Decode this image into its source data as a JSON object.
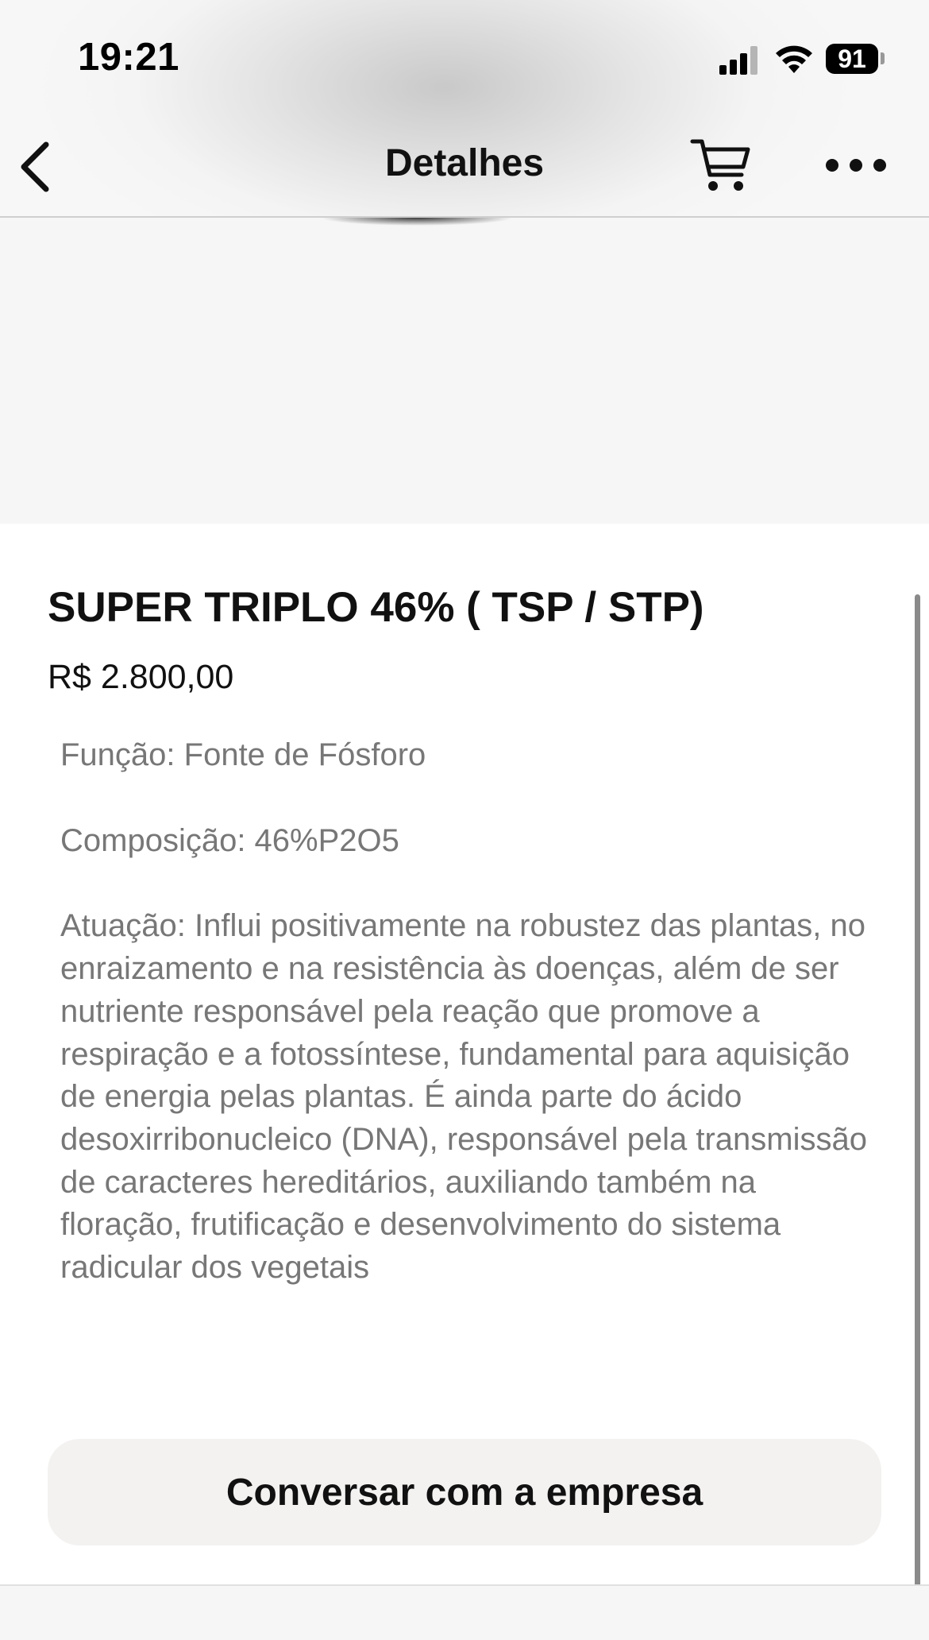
{
  "status_bar": {
    "time": "19:21",
    "battery": "91"
  },
  "nav": {
    "title": "Detalhes"
  },
  "product": {
    "title": "SUPER TRIPLO 46% ( TSP / STP)",
    "price": "R$ 2.800,00",
    "description": {
      "function": "Função: Fonte de Fósforo",
      "composition": "Composição: 46%P2O5",
      "action": "Atuação: Influi positivamente na robustez das plantas, no enraizamento e na resistência às doenças, além de ser nutriente responsável pela reação que promove a respiração e a fotossíntese, fundamental para aquisição de energia pelas plantas. É ainda parte do ácido desoxirribonucleico (DNA), responsável pela transmissão de caracteres hereditários, auxiliando também na floração, frutificação e desenvolvimento do sistema radicular dos vegetais"
    }
  },
  "actions": {
    "chat_label": "Conversar com a empresa"
  },
  "icons": {
    "back": "chevron-left-icon",
    "cart": "cart-icon",
    "more": "more-horizontal-icon",
    "signal": "cellular-signal-icon",
    "wifi": "wifi-icon",
    "battery": "battery-icon"
  }
}
